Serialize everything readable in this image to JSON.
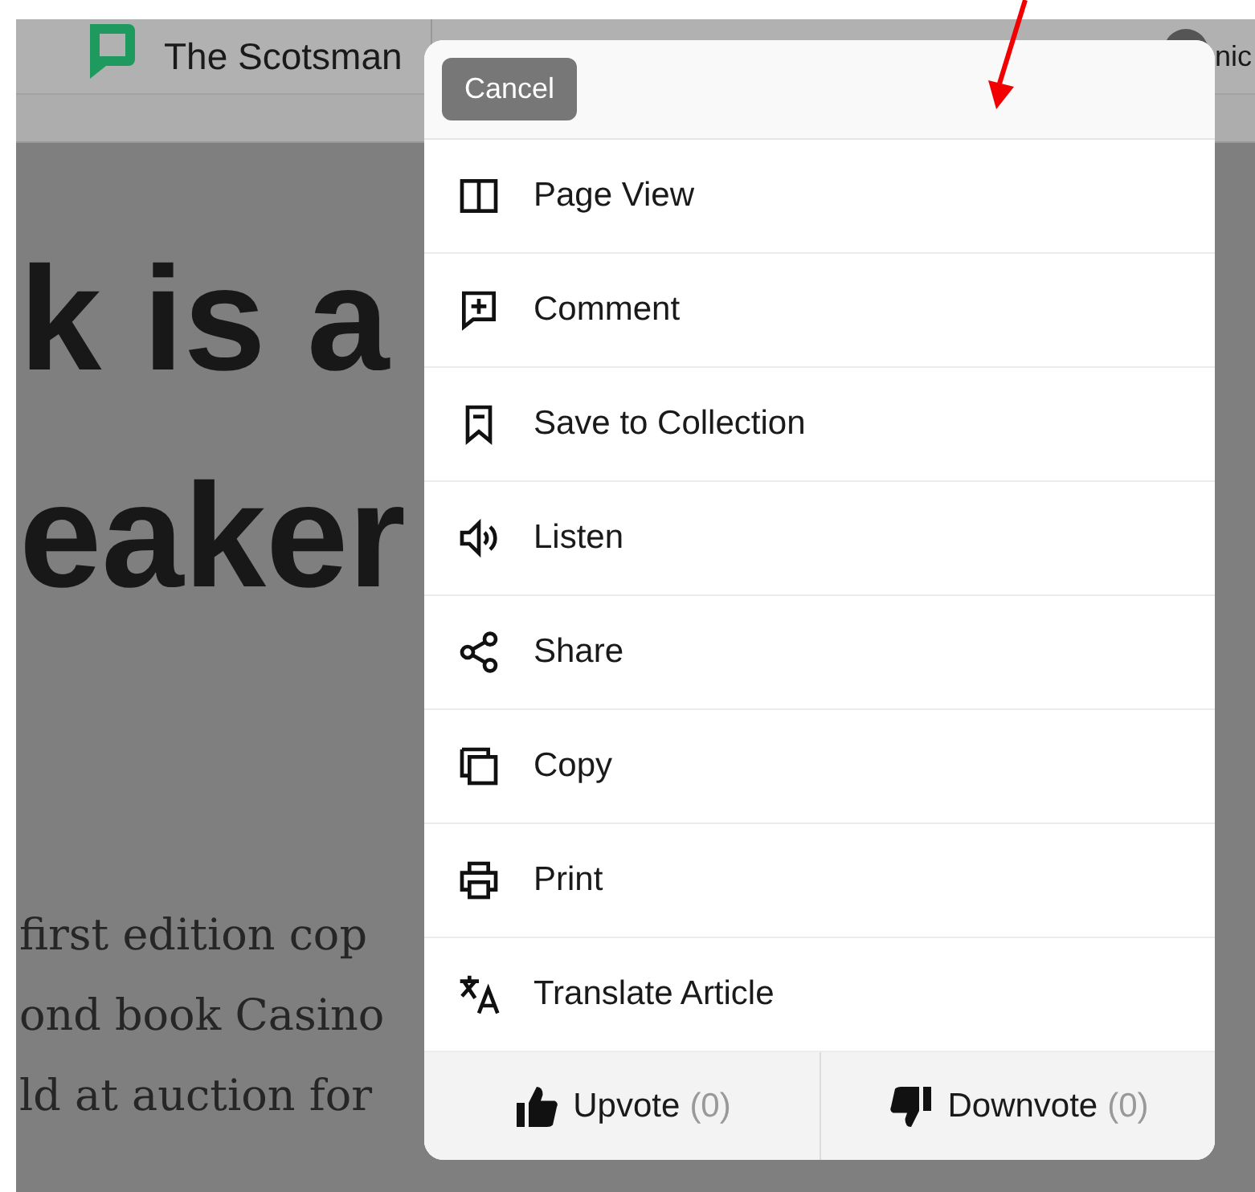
{
  "topbar": {
    "brand": "The Scotsman",
    "user": "nic"
  },
  "article": {
    "headline_left": [
      "k is a",
      "eaker"
    ],
    "body_left": [
      "first edition cop",
      "ond book Casino",
      "ld at auction for"
    ]
  },
  "menu": {
    "cancel": "Cancel",
    "items": [
      {
        "label": "Page View",
        "kind": "columns"
      },
      {
        "label": "Comment",
        "kind": "comment"
      },
      {
        "label": "Save to Collection",
        "kind": "bookmark"
      },
      {
        "label": "Listen",
        "kind": "speaker"
      },
      {
        "label": "Share",
        "kind": "share"
      },
      {
        "label": "Copy",
        "kind": "copy"
      },
      {
        "label": "Print",
        "kind": "printer"
      },
      {
        "label": "Translate Article",
        "kind": "translate"
      }
    ],
    "votes": [
      {
        "kind": "up",
        "label": "Upvote",
        "count": "(0)"
      },
      {
        "kind": "down",
        "label": "Downvote",
        "count": "(0)"
      }
    ]
  }
}
